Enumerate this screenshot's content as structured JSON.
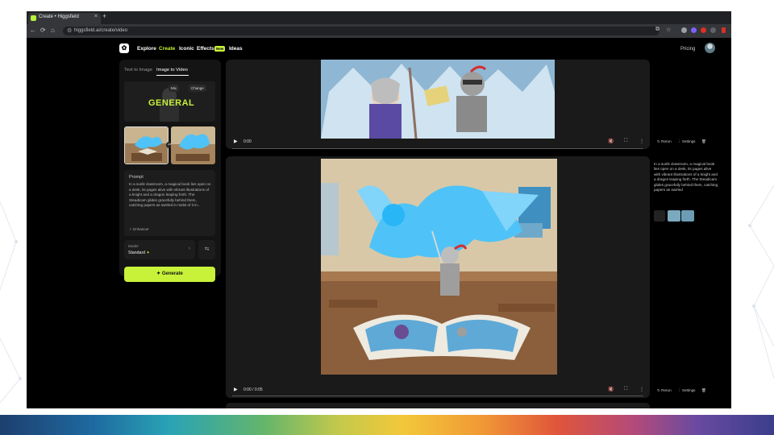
{
  "browser": {
    "tab_title": "Create • Higgsfield",
    "url": "higgsfield.ai/create/video"
  },
  "header": {
    "nav": [
      "Explore",
      "Create",
      "Iconic",
      "Effects",
      "Ideas"
    ],
    "active": "Create",
    "new_badge": "New",
    "pricing": "Pricing"
  },
  "panel": {
    "tabs": [
      "Text to Image",
      "Image to Video"
    ],
    "active_tab": "Image to Video",
    "thumb_title": "GENERAL",
    "thumb_chip_left": "Mix",
    "thumb_chip_right": "Change",
    "prompt_label": "Prompt",
    "prompt_text": "In a sunlit classroom, a magical book lies open on a desk, its pages alive with vibrant illustrations of a knight and a dragon leaping forth. The Steadicam glides gracefully behind them, catching papers as swirled in midst of it in...",
    "enhancer_label": "Enhancer",
    "model_label": "Model",
    "model_value": "Standard",
    "generate_label": "Generate"
  },
  "videos": [
    {
      "time": "0:00",
      "actions": [
        "Rerun",
        "Settings"
      ]
    },
    {
      "time": "0:00 / 0:05",
      "actions": [
        "Rerun",
        "Settings"
      ],
      "side_text": "In a sunlit classroom, a magical book lies open on a desk, its pages alive with vibrant illustrations of a knight and a dragon leaping forth. The Steadicam glides gracefully behind them, catching papers as swirled"
    }
  ],
  "colors": {
    "accent": "#c8f23a",
    "background": "#000000",
    "card": "#1a1a1a"
  }
}
